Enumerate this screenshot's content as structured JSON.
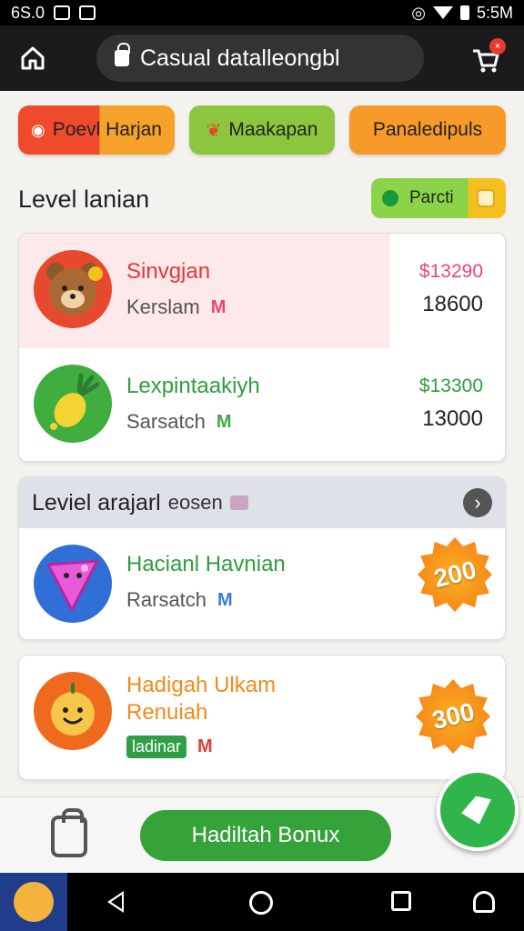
{
  "statusbar": {
    "left_text": "6S.0",
    "time": "5:5M"
  },
  "browser": {
    "url": "Casual datalleongbl",
    "cart_badge": "×"
  },
  "chips": [
    {
      "label": "Poevl Harjan",
      "icon": "swirl-icon"
    },
    {
      "label": "Maakapan",
      "icon": "leaf-icon"
    },
    {
      "label": "Panaledipuls"
    }
  ],
  "section": {
    "title": "Level lanian",
    "pill_label": "Parcti"
  },
  "card1": {
    "rows": [
      {
        "name": "Sinvgjan",
        "sub": "Kerslam",
        "m": "M",
        "price1": "$13290",
        "price2": "18600",
        "avatar": "bear-avatar",
        "name_color": "#e53935",
        "price1_color": "#e8457a",
        "m_color": "#e8457a"
      },
      {
        "name": "Lexpintaakiyh",
        "sub": "Sarsatch",
        "m": "M",
        "price1": "$13300",
        "price2": "13000",
        "avatar": "radish-avatar",
        "name_color": "#2e9e3c",
        "price1_color": "#2e9e3c",
        "m_color": "#43a843"
      }
    ]
  },
  "card2": {
    "header": "Leviel arajarl",
    "header_small": "eosen",
    "item": {
      "name": "Hacianl Havnian",
      "sub": "Rarsatch",
      "m": "M",
      "badge": "200",
      "name_color": "#2e9e3c",
      "m_color": "#3b7ad8"
    }
  },
  "card3": {
    "item": {
      "name_line1": "Hadigah Ulkam",
      "name_line2": "Renuiah",
      "tag": "ladinar",
      "m": "M",
      "badge": "300",
      "name_color": "#f08a1a",
      "m_color": "#e53935"
    }
  },
  "bottom": {
    "button_label": "Hadiltah Bonux"
  }
}
